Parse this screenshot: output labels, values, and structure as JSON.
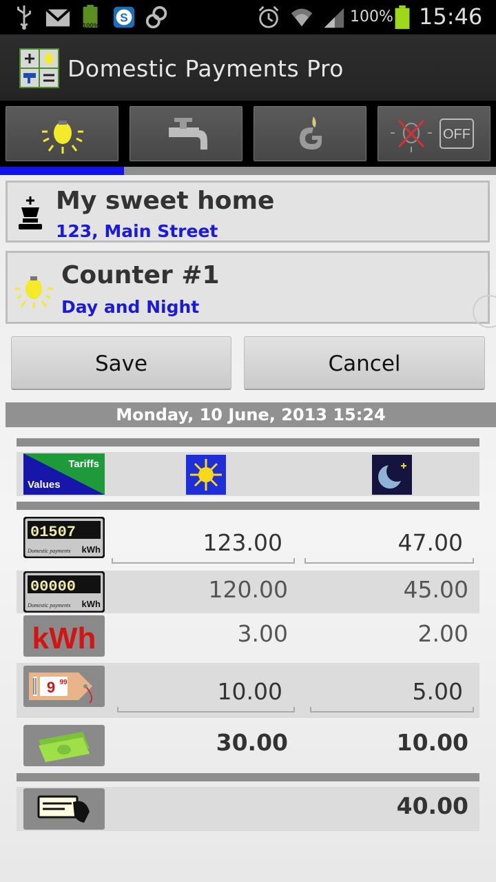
{
  "status_bar": {
    "icons": [
      "usb-icon",
      "gmail-icon",
      "battery-widget-icon",
      "skype-icon",
      "sync-icon",
      "alarm-icon",
      "wifi-icon",
      "signal-icon",
      "battery-icon"
    ],
    "battery_widget_text": "100%",
    "battery_percent": "100%",
    "time": "15:46"
  },
  "app": {
    "title": "Domestic Payments Pro",
    "icon": "calculator-app-icon"
  },
  "tabs": [
    {
      "name": "electricity",
      "icon": "lightbulb-icon",
      "active": true
    },
    {
      "name": "water",
      "icon": "faucet-icon",
      "active": false
    },
    {
      "name": "gas",
      "icon": "gas-flame-icon",
      "active": false
    },
    {
      "name": "off",
      "icon": "light-off-icon",
      "label": "OFF",
      "active": false
    }
  ],
  "home": {
    "icon": "chess-king-icon",
    "title": "My sweet home",
    "address": "123, Main Street"
  },
  "counter": {
    "icon": "lightbulb-icon",
    "title": "Counter #1",
    "subtitle": "Day and Night"
  },
  "actions": {
    "save_label": "Save",
    "cancel_label": "Cancel"
  },
  "date_label": "Monday, 10 June, 2013 15:24",
  "table": {
    "header": {
      "tariffs_label": "Tariffs",
      "values_label": "Values",
      "day_icon": "sun-icon",
      "night_icon": "moon-icon"
    },
    "current_reading": {
      "icon": "meter-current-icon",
      "digits": "01507",
      "unit": "kWh",
      "brand": "Domestic payments",
      "day": "123.00",
      "night": "47.00"
    },
    "previous_reading": {
      "icon": "meter-previous-icon",
      "digits": "00000",
      "unit": "kWh",
      "brand": "Domestic payments",
      "day": "120.00",
      "night": "45.00"
    },
    "consumption": {
      "icon": "kwh-icon",
      "icon_text": "kWh",
      "day": "3.00",
      "night": "2.00"
    },
    "price": {
      "icon": "price-tag-icon",
      "icon_text": "9",
      "icon_text_sup": "99",
      "day": "10.00",
      "night": "5.00"
    },
    "cost": {
      "icon": "money-icon",
      "day": "30.00",
      "night": "10.00"
    },
    "total": {
      "icon": "payment-card-icon",
      "value": "40.00"
    }
  },
  "colors": {
    "accent_blue": "#1212ee",
    "subtitle_blue": "#1b1bd6",
    "bulb_yellow": "#f4ea2a"
  }
}
